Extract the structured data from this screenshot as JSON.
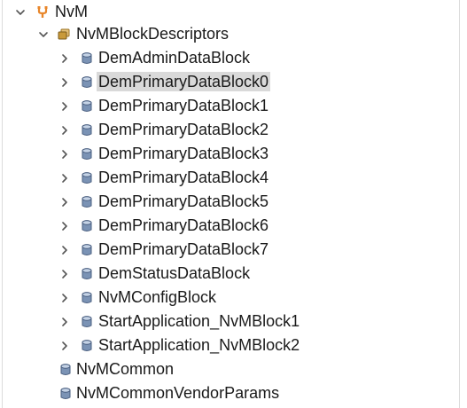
{
  "tree": {
    "root": {
      "label": "NvM",
      "expanded": true,
      "icon": "module-fork-icon",
      "icon_color": "#e8862a"
    },
    "descriptors": {
      "label": "NvMBlockDescriptors",
      "expanded": true,
      "icon": "container-folder-icon"
    },
    "blocks": [
      {
        "label": "DemAdminDataBlock",
        "selected": false
      },
      {
        "label": "DemPrimaryDataBlock0",
        "selected": true
      },
      {
        "label": "DemPrimaryDataBlock1",
        "selected": false
      },
      {
        "label": "DemPrimaryDataBlock2",
        "selected": false
      },
      {
        "label": "DemPrimaryDataBlock3",
        "selected": false
      },
      {
        "label": "DemPrimaryDataBlock4",
        "selected": false
      },
      {
        "label": "DemPrimaryDataBlock5",
        "selected": false
      },
      {
        "label": "DemPrimaryDataBlock6",
        "selected": false
      },
      {
        "label": "DemPrimaryDataBlock7",
        "selected": false
      },
      {
        "label": "DemStatusDataBlock",
        "selected": false
      },
      {
        "label": "NvMConfigBlock",
        "selected": false
      },
      {
        "label": "StartApplication_NvMBlock1",
        "selected": false
      },
      {
        "label": "StartApplication_NvMBlock2",
        "selected": false
      }
    ],
    "common": {
      "label": "NvMCommon"
    },
    "vendor_params": {
      "label": "NvMCommonVendorParams"
    },
    "colors": {
      "selection": "#d9d9d9",
      "db_icon_fill": "#7b93b5",
      "db_icon_stroke": "#4a5f80",
      "folder_icon": "#c99a3a",
      "twisty": "#555555"
    }
  }
}
